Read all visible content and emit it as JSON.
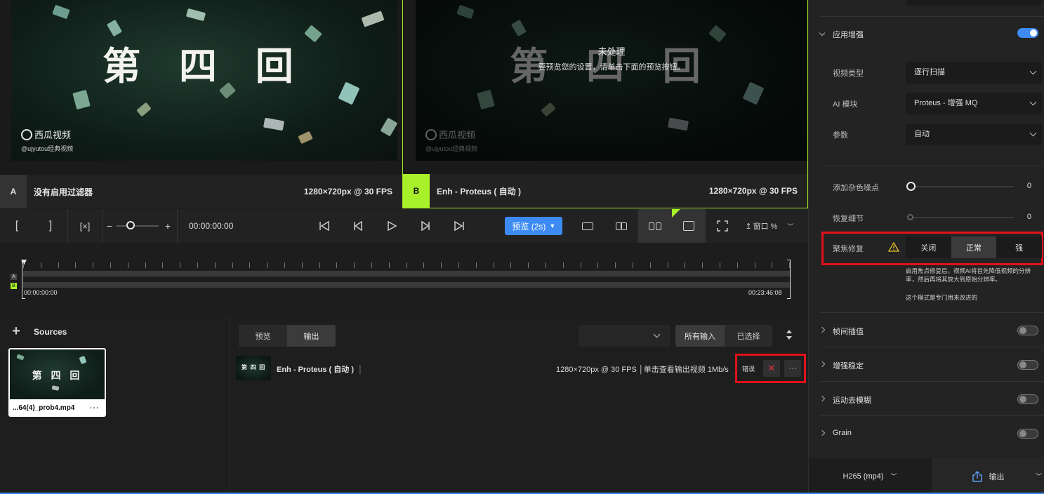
{
  "preview": {
    "frame_title": "第 四 回",
    "watermark": "西瓜视频",
    "watermark_sub": "@ujyutou经典视频",
    "pane_a": {
      "letter": "A",
      "label": "没有启用过滤器",
      "resolution": "1280×720px @ 30 FPS"
    },
    "pane_b": {
      "letter": "B",
      "label": "Enh - Proteus ( 自动 )",
      "resolution": "1280×720px @ 30 FPS",
      "unprocessed_title": "未处理",
      "unprocessed_msg": "要预览您的设置，请单击下面的预览按钮。"
    }
  },
  "transport": {
    "mark_in": "[",
    "mark_out": "]",
    "timecode": "00:00:00:00",
    "preview_button": "预览 (2s)",
    "zoom_label": "窗口 %"
  },
  "timeline": {
    "track_a": "A",
    "track_b": "B",
    "start_time": "00:00:00:00",
    "end_time": "00:23:46:08"
  },
  "sources": {
    "title": "Sources",
    "file_name": "...64(4)_prob4.mp4",
    "thumb_title": "第 四 回"
  },
  "outputs": {
    "tabs": [
      {
        "label": "预览",
        "active": false
      },
      {
        "label": "输出",
        "active": true
      }
    ],
    "filter_tabs": [
      {
        "label": "所有输入",
        "active": true
      },
      {
        "label": "已选择",
        "active": false
      }
    ],
    "row": {
      "name": "Enh - Proteus ( 自动 )",
      "meta": "1280×720px @ 30 FPS │单击查看输出视频  1Mb/s",
      "status": "错误",
      "thumb_title": "第 四 回"
    }
  },
  "right_panel": {
    "enhance_title": "应用增强",
    "enhance_enabled": true,
    "video_type_label": "视频类型",
    "video_type_value": "逐行扫描",
    "ai_model_label": "AI 模块",
    "ai_model_value": "Proteus - 增强 MQ",
    "params_label": "参数",
    "params_value": "自动",
    "noise_label": "添加杂色噪点",
    "noise_value": "0",
    "detail_label": "恢复细节",
    "detail_value": "0",
    "focus_label": "聚焦修复",
    "focus_options": [
      {
        "label": "关闭",
        "active": false
      },
      {
        "label": "正常",
        "active": true
      },
      {
        "label": "强",
        "active": false
      }
    ],
    "focus_note_1": "启用焦点修复后，视频AI将首先降低视频的分辨率，然后再将其放大到原始分辨率。",
    "focus_note_2": "这个模式是专门用来改进的",
    "sections": [
      {
        "title": "帧间插值",
        "enabled": false
      },
      {
        "title": "增强稳定",
        "enabled": false
      },
      {
        "title": "运动去模糊",
        "enabled": false
      },
      {
        "title": "Grain",
        "enabled": false
      }
    ],
    "format": "H265 (mp4)",
    "export_label": "输出"
  },
  "colors": {
    "accent_blue": "#3d8bf2",
    "pane_b_green": "#a8f02a",
    "highlight_red": "#e3101a"
  }
}
